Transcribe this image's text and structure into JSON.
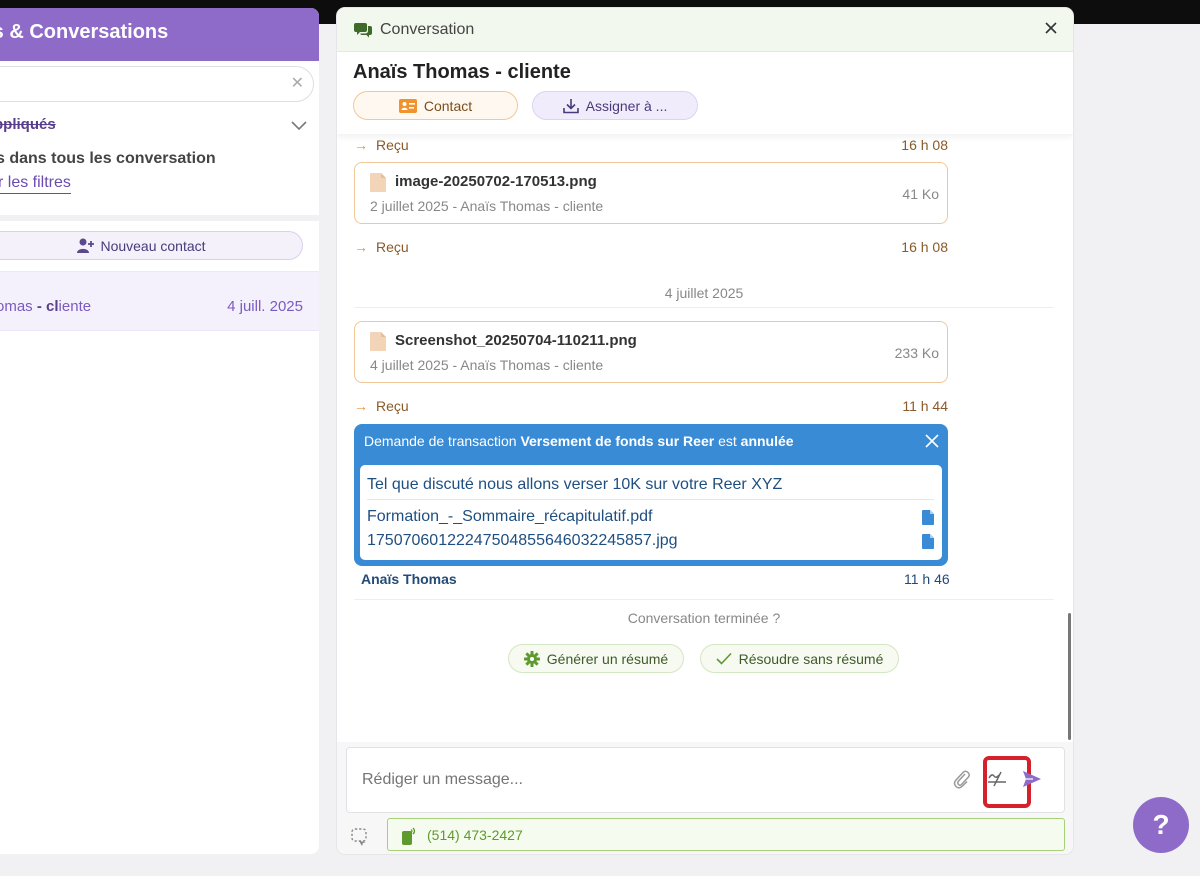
{
  "left": {
    "header_title": "ts & Conversations",
    "filter_title": "ppliqués",
    "filter_info": "s dans tous les conversation",
    "filter_link": "r les filtres",
    "new_contact_label": "Nouveau contact",
    "contact_name_pre": "omas ",
    "contact_name_bold": "- cl",
    "contact_name_post": "iente",
    "contact_date": "4 juill. 2025"
  },
  "conversation": {
    "title_label": "Conversation",
    "contact_title": "Anaïs Thomas - cliente",
    "contact_button": "Contact",
    "assign_button": "Assigner à ..."
  },
  "messages": {
    "status_1": {
      "label": "Reçu",
      "time": "16 h 08"
    },
    "file_1": {
      "name": "image-20250702-170513.png",
      "meta": "2 juillet 2025 - Anaïs Thomas - cliente",
      "size": "41 Ko"
    },
    "status_2": {
      "label": "Reçu",
      "time": "16 h 08"
    },
    "date_separator": "4 juillet 2025",
    "file_2": {
      "name": "Screenshot_20250704-110211.png",
      "meta": "4 juillet 2025 - Anaïs Thomas - cliente",
      "size": "233 Ko"
    },
    "status_3": {
      "label": "Reçu",
      "time": "11 h 44"
    },
    "transaction": {
      "prefix": "Demande de transaction ",
      "type": "Versement de fonds sur Reer",
      "middle": " est ",
      "state": "annulée",
      "description": "Tel que discuté nous allons verser 10K sur votre Reer XYZ",
      "file_1": "Formation_-_Sommaire_récapitulatif.pdf",
      "file_2": "17507060122247504855646032245857.jpg",
      "sender": "Anaïs Thomas",
      "time": "11 h 46"
    },
    "end_text": "Conversation terminée ?",
    "summary_button": "Générer un résumé",
    "resolve_button": "Résoudre sans résumé"
  },
  "composer": {
    "placeholder": "Rédiger un message...",
    "phone": "(514) 473-2427"
  },
  "help_label": "?",
  "colors": {
    "brand_purple": "#8e6bc9",
    "transaction_blue": "#3a8bd6",
    "received_orange": "#e8923c",
    "phone_green": "#5f9a2e",
    "highlight_red": "#d4212b"
  },
  "icons": {
    "conversation": "chat-bubbles-icon",
    "close": "close-icon",
    "contact": "id-card-icon",
    "assign": "download-icon",
    "file": "file-icon",
    "attach": "paperclip-icon",
    "no_signature": "no-signature-icon",
    "send": "send-icon",
    "phone": "phone-icon"
  }
}
